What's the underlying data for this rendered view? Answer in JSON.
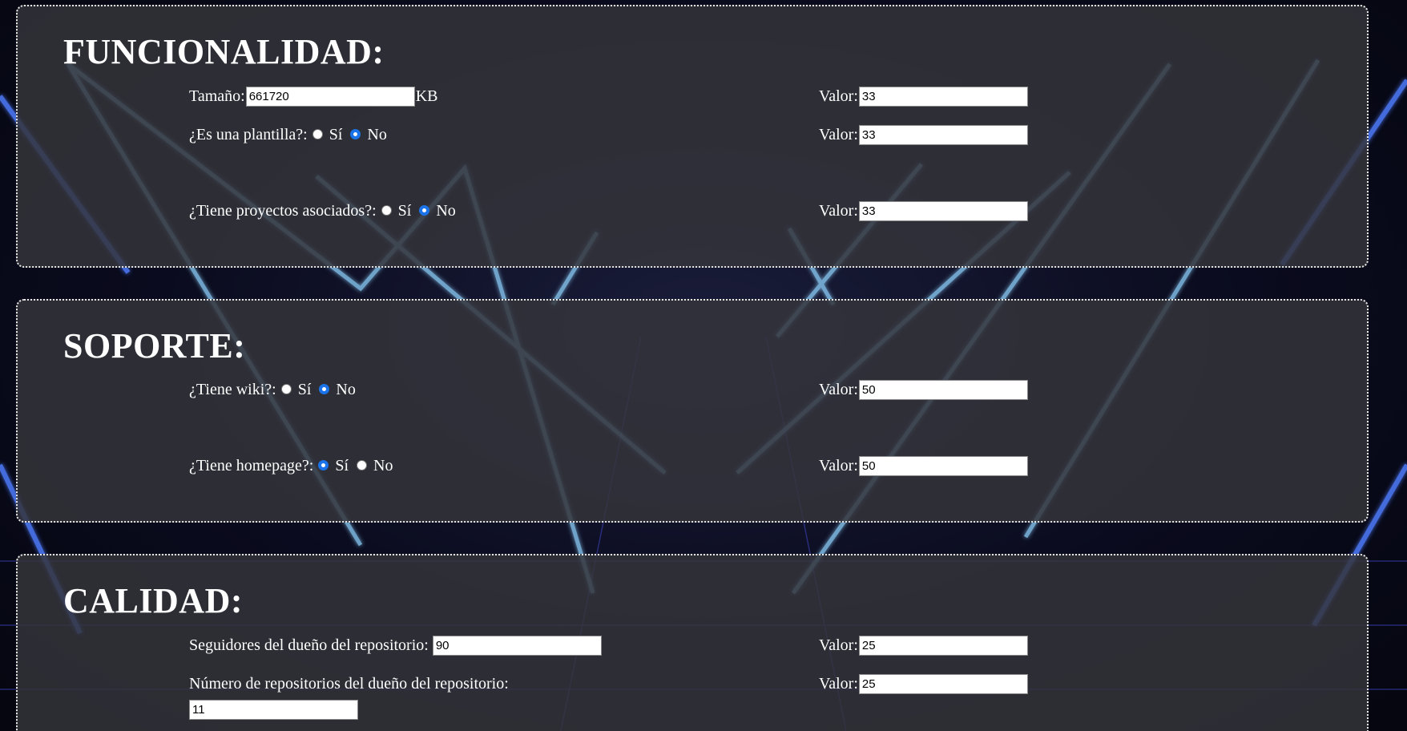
{
  "colors": {
    "radio_checked": "#1a73e8",
    "panel_border": "#e8e8e8",
    "panel_bg": "#34353a"
  },
  "funcionalidad": {
    "title": "FUNCIONALIDAD:",
    "tamano_label": "Tamaño:",
    "tamano_value": "661720",
    "tamano_unit": "KB",
    "plantilla_label": "¿Es una plantilla?:",
    "proyectos_label": "¿Tiene proyectos asociados?:",
    "valor_label": "Valor:",
    "valores": [
      "33",
      "33",
      "33"
    ]
  },
  "soporte": {
    "title": "SOPORTE:",
    "wiki_label": "¿Tiene wiki?:",
    "homepage_label": "¿Tiene homepage?:",
    "valor_label": "Valor:",
    "valores": [
      "50",
      "50"
    ]
  },
  "calidad": {
    "title": "CALIDAD:",
    "seguidores_label": "Seguidores del dueño del repositorio:",
    "seguidores_value": "90",
    "num_repos_label": "Número de repositorios del dueño del repositorio:",
    "num_repos_value": "11",
    "valor_label": "Valor:",
    "valores": [
      "25",
      "25"
    ]
  },
  "radio": {
    "si": "Sí",
    "no": "No"
  },
  "selections": {
    "plantilla": "No",
    "proyectos": "No",
    "wiki": "No",
    "homepage": "Sí"
  }
}
